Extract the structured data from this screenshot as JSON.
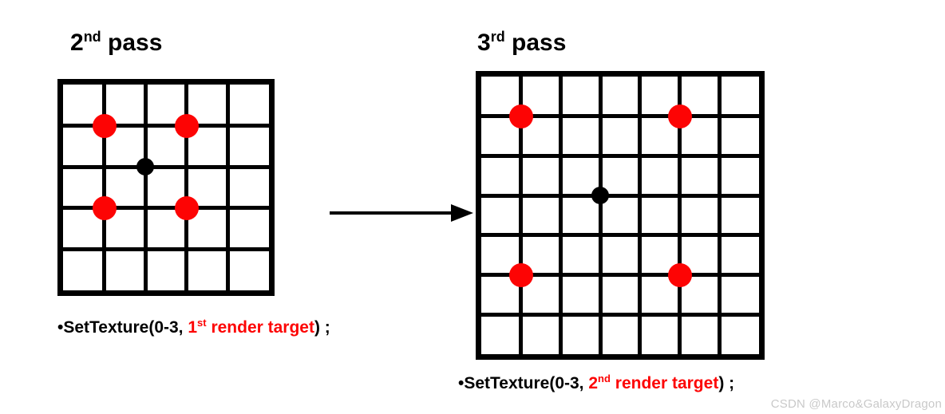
{
  "left": {
    "title_pre": "2",
    "title_sup": "nd",
    "title_post": " pass",
    "grid_size": 5,
    "dots_red": [
      {
        "col": 1,
        "row": 1
      },
      {
        "col": 3,
        "row": 1
      },
      {
        "col": 1,
        "row": 3
      },
      {
        "col": 3,
        "row": 3
      }
    ],
    "dot_black": {
      "col": 2,
      "row": 2
    },
    "caption_prefix": "•SetTexture(0-3, ",
    "caption_num": "1",
    "caption_sup": "st",
    "caption_red_post": " render target",
    "caption_suffix": ") ;"
  },
  "right": {
    "title_pre": "3",
    "title_sup": "rd",
    "title_post": " pass",
    "grid_size": 7,
    "dots_red": [
      {
        "col": 1,
        "row": 1
      },
      {
        "col": 5,
        "row": 1
      },
      {
        "col": 1,
        "row": 5
      },
      {
        "col": 5,
        "row": 5
      }
    ],
    "dot_black": {
      "col": 3,
      "row": 3
    },
    "caption_prefix": "•SetTexture(0-3, ",
    "caption_num": "2",
    "caption_sup": "nd",
    "caption_red_post": " render target",
    "caption_suffix": ") ;"
  },
  "watermark": "CSDN @Marco&GalaxyDragon"
}
